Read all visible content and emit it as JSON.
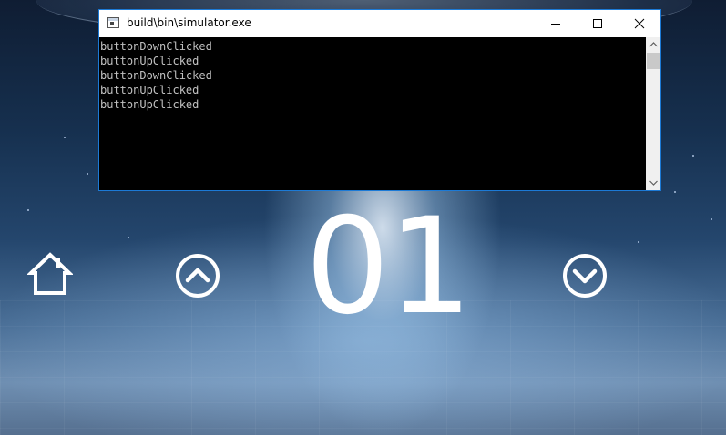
{
  "window": {
    "title": "build\\bin\\simulator.exe",
    "log_lines": [
      "buttonDownClicked",
      "buttonUpClicked",
      "buttonDownClicked",
      "buttonUpClicked",
      "buttonUpClicked"
    ]
  },
  "controls": {
    "home_icon": "home-icon",
    "up_icon": "chevron-up-circle-icon",
    "down_icon": "chevron-down-circle-icon"
  },
  "display": {
    "counter": "01"
  },
  "colors": {
    "console_background": "#000000",
    "console_text": "#c0c0c0",
    "window_border": "#1c7ad6",
    "icon_color": "#ffffff"
  }
}
